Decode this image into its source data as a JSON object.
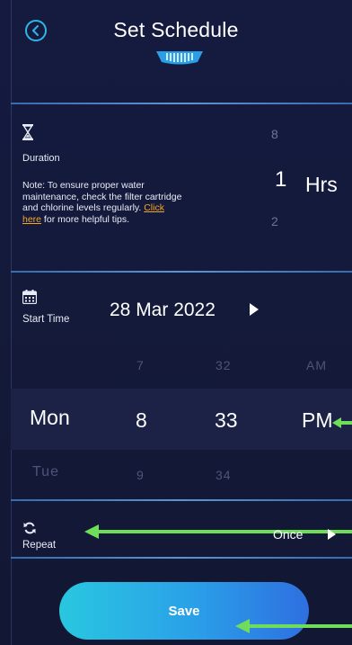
{
  "header": {
    "title": "Set Schedule"
  },
  "duration": {
    "label": "Duration",
    "note_prefix": "Note: To ensure proper water maintenance, check the filter cartridge and chlorine levels regularly. ",
    "note_link": "Click here",
    "note_suffix": " for more helpful tips.",
    "picker_above": "8",
    "picker_selected": "1",
    "picker_below": "2",
    "unit": "Hrs"
  },
  "start_time": {
    "label": "Start Time",
    "date": "28 Mar 2022",
    "picker": {
      "above": {
        "hour": "7",
        "minute": "32",
        "period": "AM"
      },
      "selected": {
        "day": "Mon",
        "hour": "8",
        "minute": "33",
        "period": "PM"
      },
      "below": {
        "day": "Tue",
        "hour": "9",
        "minute": "34"
      }
    }
  },
  "repeat": {
    "label": "Repeat",
    "value": "Once"
  },
  "save": {
    "label": "Save"
  },
  "colors": {
    "background": "#141a3a",
    "accent": "#2fb6e9",
    "link": "#f5a623",
    "annotation_arrow": "#6fdc5a"
  },
  "icons": [
    "back-icon",
    "device-icon",
    "hourglass-icon",
    "calendar-icon",
    "chevron-right-icon",
    "repeat-icon"
  ]
}
